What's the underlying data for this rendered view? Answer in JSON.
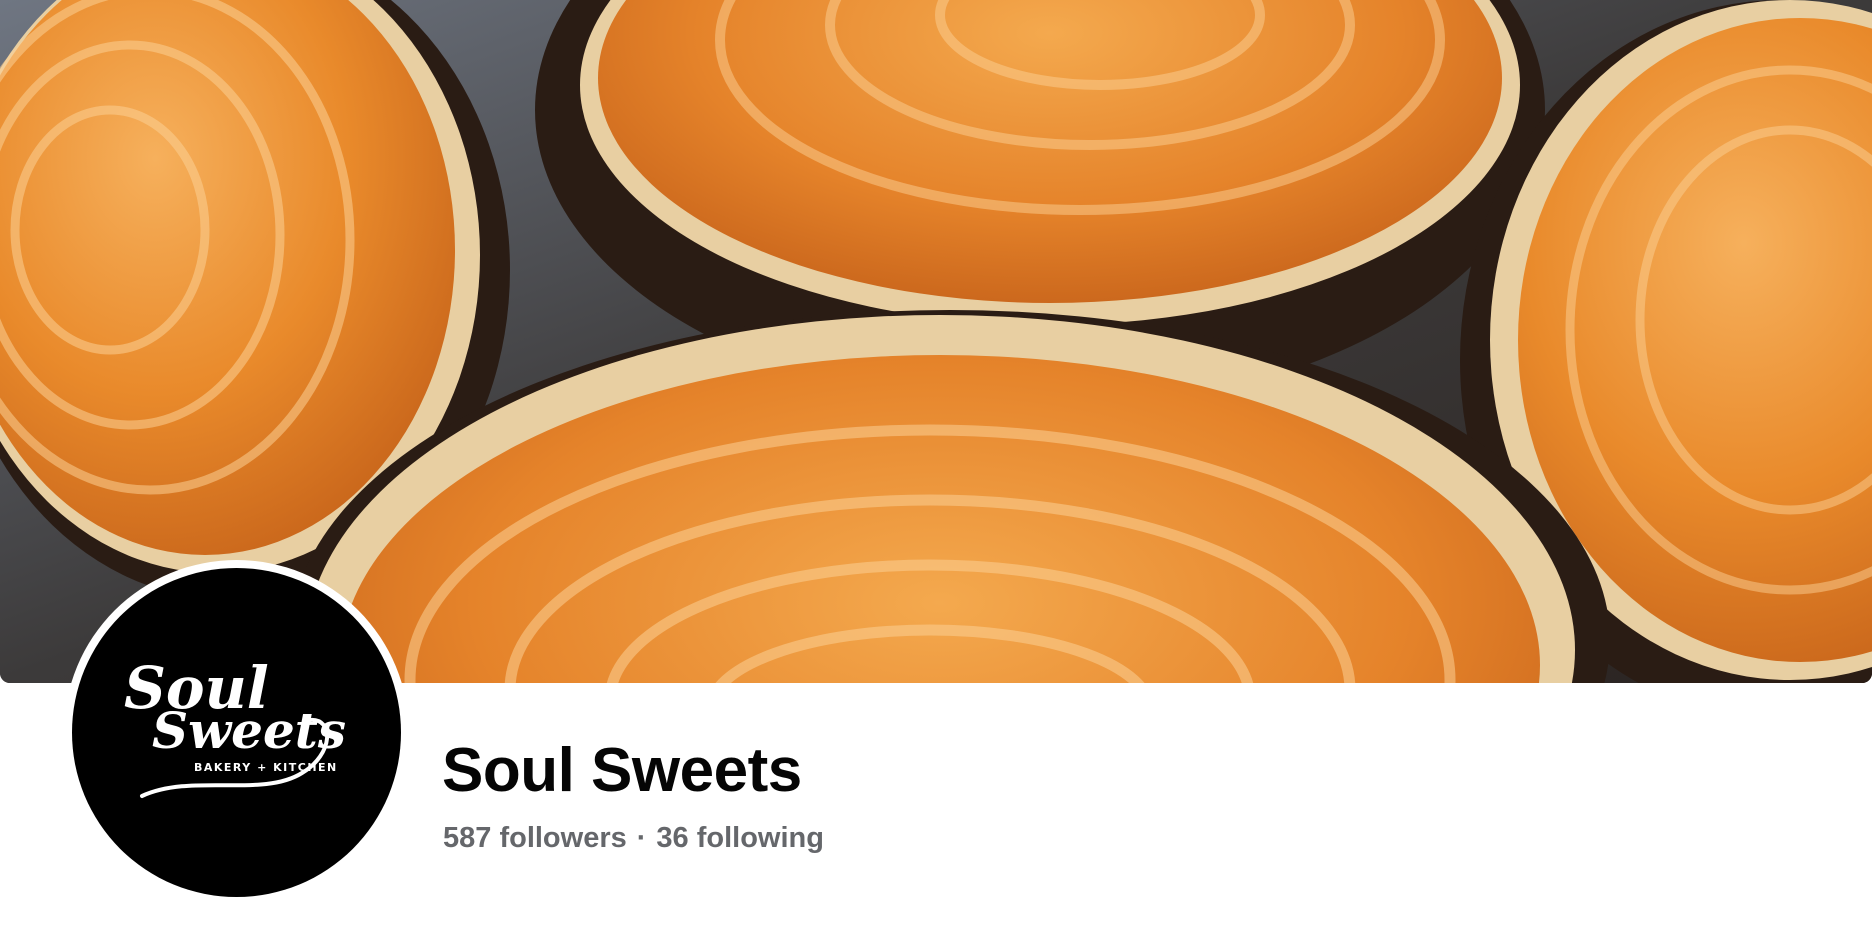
{
  "cover": {
    "image": "cover-photo-sweet-potato-pies",
    "colors": {
      "filling": "#e98a2b",
      "filling_light": "#f6b05c",
      "crust": "#e8cfa2",
      "pan": "#2a1c14",
      "background": "#3a342f"
    }
  },
  "profile": {
    "logo": {
      "line1": "Soul",
      "line2": "Sweets",
      "tagline": "BAKERY + KITCHEN"
    },
    "colors": {
      "avatar_bg": "#000000",
      "logo_text": "#ffffff"
    }
  },
  "page": {
    "name": "Soul Sweets",
    "followers": "587 followers",
    "separator": "·",
    "following": "36 following"
  },
  "colors": {
    "name_text": "#050505",
    "secondary_text": "#65676b"
  }
}
